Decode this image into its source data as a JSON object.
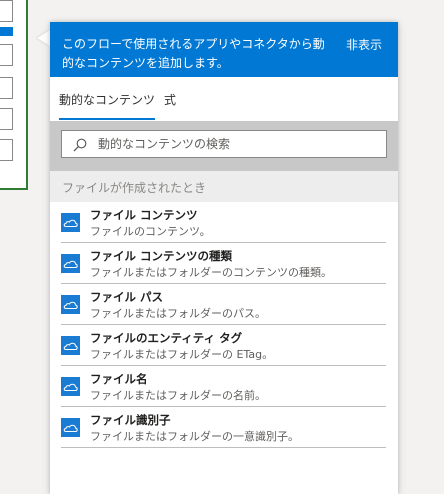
{
  "panel": {
    "description": "このフローで使用されるアプリやコネクタから動的なコンテンツを追加します。",
    "hide_label": "非表示"
  },
  "tabs": [
    {
      "label": "動的なコンテンツ",
      "active": true
    },
    {
      "label": "式",
      "active": false
    }
  ],
  "search": {
    "placeholder": "動的なコンテンツの検索",
    "value": ""
  },
  "section": {
    "title": "ファイルが作成されたとき"
  },
  "items": [
    {
      "title": "ファイル コンテンツ",
      "description": "ファイルのコンテンツ。",
      "icon": "onedrive-cloud-icon"
    },
    {
      "title": "ファイル コンテンツの種類",
      "description": "ファイルまたはフォルダーのコンテンツの種類。",
      "icon": "onedrive-cloud-icon"
    },
    {
      "title": "ファイル パス",
      "description": "ファイルまたはフォルダーのパス。",
      "icon": "onedrive-cloud-icon"
    },
    {
      "title": "ファイルのエンティティ タグ",
      "description": "ファイルまたはフォルダーの ETag。",
      "icon": "onedrive-cloud-icon"
    },
    {
      "title": "ファイル名",
      "description": "ファイルまたはフォルダーの名前。",
      "icon": "onedrive-cloud-icon"
    },
    {
      "title": "ファイル識別子",
      "description": "ファイルまたはフォルダーの一意識別子。",
      "icon": "onedrive-cloud-icon"
    }
  ],
  "colors": {
    "accent": "#0078d4",
    "icon_bg": "#1a7bd3",
    "form_border": "#2e7d32"
  }
}
